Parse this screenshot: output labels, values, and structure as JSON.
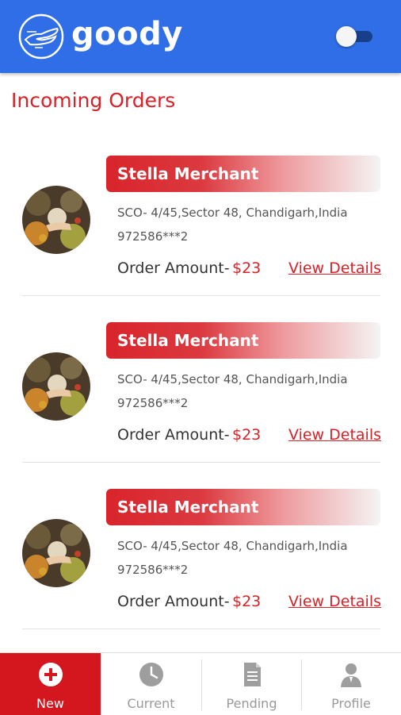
{
  "header": {
    "brand": "goody",
    "theme_toggle": "off"
  },
  "page": {
    "title": "Incoming Orders"
  },
  "orders": [
    {
      "merchant": "Stella Merchant",
      "address": "SCO- 4/45,Sector 48, Chandigarh,India",
      "phone": "972586***2",
      "amount_label": "Order Amount-",
      "amount": "$23",
      "action": "View Details"
    },
    {
      "merchant": "Stella Merchant",
      "address": "SCO- 4/45,Sector 48, Chandigarh,India",
      "phone": "972586***2",
      "amount_label": "Order Amount-",
      "amount": "$23",
      "action": "View Details"
    },
    {
      "merchant": "Stella Merchant",
      "address": "SCO- 4/45,Sector 48, Chandigarh,India",
      "phone": "972586***2",
      "amount_label": "Order Amount-",
      "amount": "$23",
      "action": "View Details"
    }
  ],
  "tabs": [
    {
      "label": "New",
      "icon": "plus-circle-icon",
      "active": true
    },
    {
      "label": "Current",
      "icon": "clock-icon",
      "active": false
    },
    {
      "label": "Pending",
      "icon": "document-icon",
      "active": false
    },
    {
      "label": "Profile",
      "icon": "user-icon",
      "active": false
    }
  ],
  "colors": {
    "header_bg": "#2f6ee6",
    "accent_red": "#d92127",
    "tab_active_bg": "#d4171f"
  }
}
